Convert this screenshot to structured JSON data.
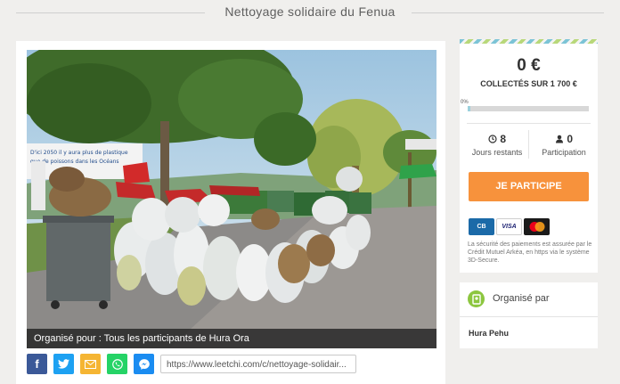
{
  "page": {
    "title": "Nettoyage solidaire du Fenua"
  },
  "photo": {
    "description_icon": "photo",
    "organizer_banner": "Organisé pour : Tous les participants de Hura Ora",
    "banner_sign_text": "D'ici 2050 il y aura plus de plastique que de poissons dans les Océans"
  },
  "share": {
    "buttons": [
      {
        "label": "f",
        "icon": "facebook-icon",
        "color": "#3b5998"
      },
      {
        "label": "t",
        "icon": "twitter-icon",
        "color": "#1da1f2"
      },
      {
        "label": "✉",
        "icon": "email-icon",
        "color": "#f5b533"
      },
      {
        "label": "✆",
        "icon": "whatsapp-icon",
        "color": "#25d366"
      },
      {
        "label": "m",
        "icon": "messenger-icon",
        "color": "#1a8cf1"
      }
    ],
    "url": "https://www.leetchi.com/c/nettoyage-solidair..."
  },
  "funding": {
    "amount": "0 €",
    "collected_label": "COLLECTÉS SUR 1 700 €",
    "progress_label": "0%",
    "progress_fraction": 0.02,
    "days_value": "8",
    "days_label": "Jours restants",
    "participants_value": "0",
    "participants_label": "Participation",
    "cta_label": "JE PARTICIPE",
    "cta_color": "#f7923c",
    "payment_methods": [
      "CB",
      "VISA",
      "MasterCard"
    ],
    "secure_text": "La sécurité des paiements est assurée par le Crédit Mutuel Arkéa, en https via le système 3D-Secure."
  },
  "organizer": {
    "heading": "Organisé par",
    "name": "Hura Pehu"
  }
}
